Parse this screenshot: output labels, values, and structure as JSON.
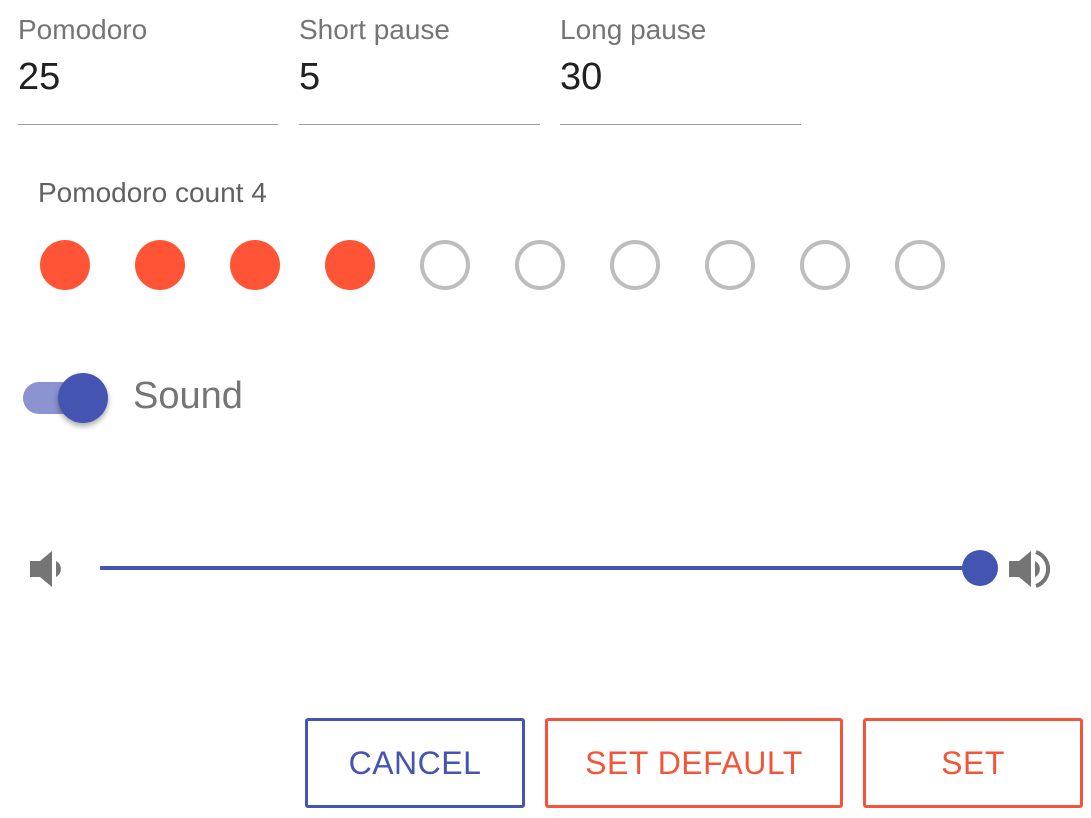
{
  "colors": {
    "accent": "#ff5436",
    "primary": "#4355b0",
    "primary_light": "#8b93d1",
    "inactive": "#bdbdbd"
  },
  "fields": {
    "pomodoro": {
      "label": "Pomodoro",
      "value": "25"
    },
    "short_pause": {
      "label": "Short pause",
      "value": "5"
    },
    "long_pause": {
      "label": "Long pause",
      "value": "30"
    }
  },
  "pomodoro_count": {
    "label": "Pomodoro count 4",
    "selected": 4,
    "max": 10
  },
  "sound": {
    "label": "Sound",
    "enabled": true
  },
  "volume": {
    "level_percent": 100,
    "low_icon": "volume-down-icon",
    "high_icon": "volume-up-icon"
  },
  "buttons": {
    "cancel": "CANCEL",
    "set_default": "SET DEFAULT",
    "set": "SET"
  }
}
